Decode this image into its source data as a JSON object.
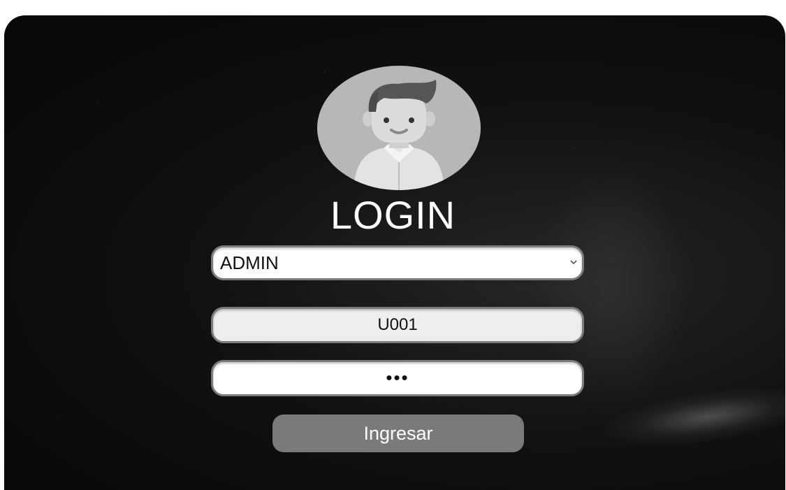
{
  "login": {
    "title": "LOGIN",
    "role_select": {
      "selected": "ADMIN"
    },
    "username_value": "U001",
    "password_masked": "•••",
    "submit_label": "Ingresar"
  },
  "icons": {
    "avatar": "user-avatar-icon",
    "select_arrow": "chevron-down-icon"
  },
  "colors": {
    "background": "#0b0b0b",
    "avatar_bg": "#b7b7b7",
    "button": "#7a7a7a",
    "field_border": "#7c7c7c"
  }
}
